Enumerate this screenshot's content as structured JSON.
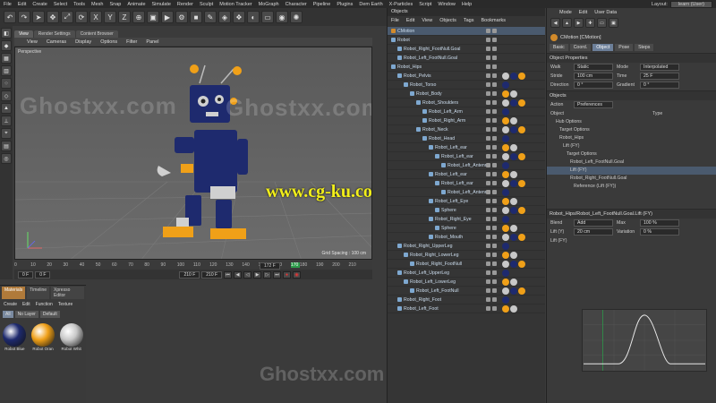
{
  "menubar": {
    "items": [
      "File",
      "Edit",
      "Create",
      "Select",
      "Tools",
      "Mesh",
      "Snap",
      "Animate",
      "Simulate",
      "Render",
      "Sculpt",
      "Motion Tracker",
      "MoGraph",
      "Character",
      "Pipeline",
      "Plugins",
      "Dem Earth",
      "X-Particles",
      "Script",
      "Window",
      "Help"
    ],
    "layout_label": "Layout:",
    "layout_value": "learn (User)"
  },
  "viewport": {
    "tabs": [
      "View",
      "Render Settings",
      "Content Browser"
    ],
    "menu": [
      "View",
      "Cameras",
      "Display",
      "Options",
      "Filter",
      "Panel"
    ],
    "label": "Perspective",
    "grid_spacing": "Grid Spacing : 100 cm"
  },
  "timeline": {
    "ticks": [
      "0",
      "10",
      "20",
      "30",
      "40",
      "50",
      "60",
      "70",
      "80",
      "90",
      "100",
      "110",
      "120",
      "130",
      "140",
      "150",
      "160",
      "170",
      "180",
      "190",
      "200",
      "210"
    ],
    "current_frame": "0 F",
    "start_field": "0 F",
    "end_field": "210 F",
    "end_field_2": "210 F",
    "frame_field": "172 F"
  },
  "materials": {
    "tabs": [
      "Materials",
      "Timeline",
      "Xpresso Editor"
    ],
    "menu": [
      "Create",
      "Edit",
      "Function",
      "Texture"
    ],
    "filters": [
      "All",
      "No Layer",
      "Default"
    ],
    "items": [
      {
        "name": "Robot Blue",
        "color": "#1e2a6e"
      },
      {
        "name": "Robot Oran",
        "color": "#f0a018"
      },
      {
        "name": "Robot Whit",
        "color": "#c8c8c8"
      }
    ]
  },
  "objects": {
    "title": "Objects",
    "menu": [
      "File",
      "Edit",
      "View",
      "Objects",
      "Tags",
      "Bookmarks"
    ],
    "rows": [
      {
        "name": "CMotion",
        "level": 0
      },
      {
        "name": "Robot",
        "level": 0
      },
      {
        "name": "Robot_Right_FootNull.Goal",
        "level": 1
      },
      {
        "name": "Robot_Left_FootNull.Goal",
        "level": 1
      },
      {
        "name": "Robot_Hips",
        "level": 0
      },
      {
        "name": "Robot_Pelvis",
        "level": 1
      },
      {
        "name": "Robot_Torso",
        "level": 2
      },
      {
        "name": "Robot_Body",
        "level": 3
      },
      {
        "name": "Robot_Shoulders",
        "level": 4
      },
      {
        "name": "Robot_Left_Arm",
        "level": 5
      },
      {
        "name": "Robot_Right_Arm",
        "level": 5
      },
      {
        "name": "Robot_Neck",
        "level": 4
      },
      {
        "name": "Robot_Head",
        "level": 5
      },
      {
        "name": "Robot_Left_ear",
        "level": 6
      },
      {
        "name": "Robot_Left_ear",
        "level": 7
      },
      {
        "name": "Robot_Left_Antenna",
        "level": 8
      },
      {
        "name": "Robot_Left_ear",
        "level": 6
      },
      {
        "name": "Robot_Left_ear",
        "level": 7
      },
      {
        "name": "Robot_Left_Antenna",
        "level": 8
      },
      {
        "name": "Robot_Left_Eye",
        "level": 6
      },
      {
        "name": "Sphere",
        "level": 7
      },
      {
        "name": "Robot_Right_Eye",
        "level": 6
      },
      {
        "name": "Sphere",
        "level": 7
      },
      {
        "name": "Robot_Mouth",
        "level": 6
      },
      {
        "name": "Robot_Right_UpperLeg",
        "level": 1
      },
      {
        "name": "Robot_Right_LowerLeg",
        "level": 2
      },
      {
        "name": "Robot_Right_FootNull",
        "level": 3
      },
      {
        "name": "Robot_Left_UpperLeg",
        "level": 1
      },
      {
        "name": "Robot_Left_LowerLeg",
        "level": 2
      },
      {
        "name": "Robot_Left_FootNull",
        "level": 3
      },
      {
        "name": "Robot_Right_Foot",
        "level": 1
      },
      {
        "name": "Robot_Left_Foot",
        "level": 1
      }
    ]
  },
  "attributes": {
    "menu": [
      "Mode",
      "Edit",
      "User Data"
    ],
    "title": "CMotion [CMotion]",
    "tabs": [
      "Basic",
      "Coord.",
      "Object",
      "Pose",
      "Steps"
    ],
    "section_props": "Object Properties",
    "walk_label": "Walk",
    "walk_value": "Static",
    "mode_label": "Mode",
    "mode_value": "Interpolated",
    "stride_label": "Stride",
    "stride_value": "100 cm",
    "time_label": "Time",
    "time_value": "25 F",
    "direction_label": "Direction",
    "direction_value": "0 °",
    "gradient_label": "Gradient",
    "gradient_value": "0 °",
    "section_objects": "Objects",
    "action_label": "Action",
    "action_value": "Preferences",
    "col_object": "Object",
    "col_type": "Type",
    "tree": [
      "Hub Options",
      "Target Options",
      "Robot_Hips",
      "Lift (FY)",
      "Target Options",
      "Robot_Left_FootNull.Goal",
      "Lift (FY)",
      "Robot_Right_FootNull.Goal",
      "Reference (Lift (FY))"
    ],
    "section_lift": "Robot_Hips/Robot_Left_FootNull.Goal.Lift (FY)",
    "blend_label": "Blend",
    "blend_value": "Add",
    "max_label": "Max",
    "max_value": "100 %",
    "lift_label": "Lift (Y)",
    "lift_value": "20 cm",
    "variation_label": "Variation",
    "variation_value": "0 %",
    "lift_fy_label": "Lift (FY)"
  },
  "watermarks": {
    "ghost": "Ghostxx.com",
    "cgku": "www.cg-ku.com"
  },
  "colors": {
    "robot_blue": "#1e2a6e",
    "robot_orange": "#f0a018",
    "accent_blue": "#6c7f99"
  }
}
